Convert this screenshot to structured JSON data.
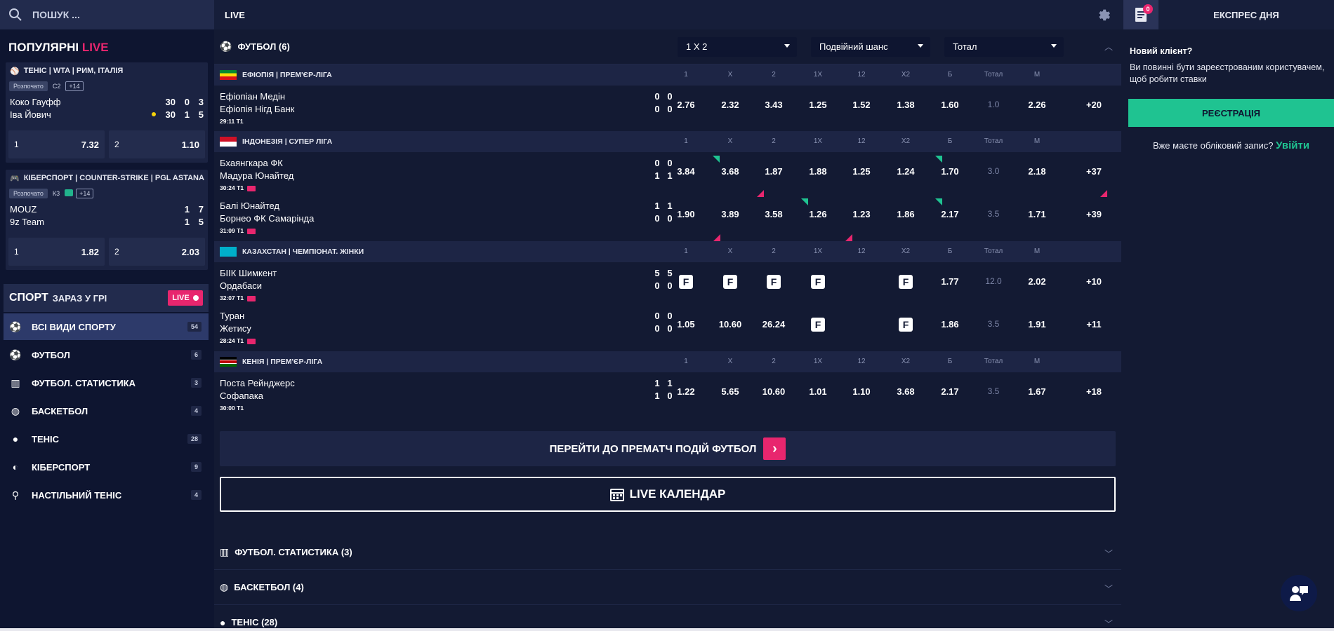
{
  "header": {
    "search_placeholder": "ПОШУК ...",
    "live_label": "LIVE",
    "betslip_count": "0",
    "express_label": "ЕКСПРЕС ДНЯ"
  },
  "popular": {
    "title_main": "ПОПУЛЯРНІ",
    "title_live": "LIVE",
    "cards": [
      {
        "header": "ТЕНІС | WTA | РИМ, ІТАЛІЯ",
        "status": "Розпочато",
        "set_label": "С2",
        "more": "+14",
        "team1": "Коко Гауфф",
        "t1s1": "30",
        "t1s2": "0",
        "t1s3": "3",
        "team2": "Іва Йович",
        "t2s1": "30",
        "t2s2": "1",
        "t2s3": "5",
        "odd1_label": "1",
        "odd1": "7.32",
        "odd2_label": "2",
        "odd2": "1.10"
      },
      {
        "header": "КІБЕРСПОРТ | COUNTER-STRIKE | PGL ASTANA",
        "status": "Розпочато",
        "set_label": "К3",
        "more": "+14",
        "team1": "MOUZ",
        "t1s1": "1",
        "t1s2": "7",
        "team2": "9z Team",
        "t2s1": "1",
        "t2s2": "5",
        "odd1_label": "1",
        "odd1": "1.82",
        "odd2_label": "2",
        "odd2": "2.03"
      }
    ]
  },
  "sports_nav": {
    "title_main": "СПОРТ",
    "title_sub": "ЗАРАЗ У ГРІ",
    "live_pill": "LIVE",
    "items": [
      {
        "label": "ВСІ ВИДИ СПОРТУ",
        "count": "54"
      },
      {
        "label": "ФУТБОЛ",
        "count": "6"
      },
      {
        "label": "ФУТБОЛ. СТАТИСТИКА",
        "count": "3"
      },
      {
        "label": "БАСКЕТБОЛ",
        "count": "4"
      },
      {
        "label": "ТЕНІС",
        "count": "28"
      },
      {
        "label": "КІБЕРСПОРТ",
        "count": "9"
      },
      {
        "label": "НАСТІЛЬНИЙ ТЕНІС",
        "count": "4"
      }
    ]
  },
  "main": {
    "football_title": "ФУТБОЛ (6)",
    "dropdowns": [
      "1 X 2",
      "Подвійний шанс",
      "Тотал"
    ],
    "columns": [
      "1",
      "X",
      "2",
      "1X",
      "12",
      "X2",
      "Б",
      "Тотал",
      "М"
    ],
    "leagues": [
      {
        "name": "ЕФІОПІЯ | ПРЕМ'ЄР-ЛІГА",
        "matches": [
          {
            "team1": "Ефіопіан Медін",
            "team2": "Ефіопія Нігд Банк",
            "time": "29:11",
            "period": "T1",
            "s1a": "0",
            "s1b": "0",
            "s2a": "0",
            "s2b": "0",
            "odds": [
              "2.76",
              "2.32",
              "3.43",
              "1.25",
              "1.52",
              "1.38",
              "1.60",
              "1.0",
              "2.26"
            ],
            "more": "+20"
          }
        ]
      },
      {
        "name": "ІНДОНЕЗІЯ | СУПЕР ЛІГА",
        "matches": [
          {
            "team1": "Бхаянгкара ФК",
            "team2": "Мадура Юнайтед",
            "time": "30:24",
            "period": "T1",
            "s1a": "0",
            "s1b": "0",
            "s2a": "1",
            "s2b": "1",
            "odds": [
              "3.84",
              "3.68",
              "1.87",
              "1.88",
              "1.25",
              "1.24",
              "1.70",
              "3.0",
              "2.18"
            ],
            "more": "+37"
          },
          {
            "team1": "Балі Юнайтед",
            "team2": "Борнео ФК Самарінда",
            "time": "31:09",
            "period": "T1",
            "s1a": "1",
            "s1b": "1",
            "s2a": "0",
            "s2b": "0",
            "odds": [
              "1.90",
              "3.89",
              "3.58",
              "1.26",
              "1.23",
              "1.86",
              "2.17",
              "3.5",
              "1.71"
            ],
            "more": "+39"
          }
        ]
      },
      {
        "name": "КАЗАХСТАН | ЧЕМПІОНАТ. ЖІНКИ",
        "matches": [
          {
            "team1": "БІІК Шимкент",
            "team2": "Ордабаси",
            "time": "32:07",
            "period": "T1",
            "s1a": "5",
            "s1b": "5",
            "s2a": "0",
            "s2b": "0",
            "odds": [
              "F",
              "F",
              "F",
              "F",
              "",
              "F",
              "1.77",
              "12.0",
              "2.02"
            ],
            "more": "+10"
          },
          {
            "team1": "Туран",
            "team2": "Жетису",
            "time": "28:24",
            "period": "T1",
            "s1a": "0",
            "s1b": "0",
            "s2a": "0",
            "s2b": "0",
            "odds": [
              "1.05",
              "10.60",
              "26.24",
              "F",
              "",
              "F",
              "1.86",
              "3.5",
              "1.91"
            ],
            "more": "+11"
          }
        ]
      },
      {
        "name": "КЕНІЯ | ПРЕМ'ЄР-ЛІГА",
        "matches": [
          {
            "team1": "Поста Рейнджерс",
            "team2": "Софапака",
            "time": "30:00",
            "period": "T1",
            "s1a": "1",
            "s1b": "1",
            "s2a": "1",
            "s2b": "0",
            "odds": [
              "1.22",
              "5.65",
              "10.60",
              "1.01",
              "1.10",
              "3.68",
              "2.17",
              "3.5",
              "1.67"
            ],
            "more": "+18"
          }
        ]
      }
    ],
    "prematch_label": "ПЕРЕЙТИ ДО ПРЕМАТЧ ПОДІЙ ФУТБОЛ",
    "calendar_label": "LIVE КАЛЕНДАР",
    "collapsed_sections": [
      "ФУТБОЛ. СТАТИСТИКА (3)",
      "БАСКЕТБОЛ (4)",
      "ТЕНІС (28)"
    ]
  },
  "right_panel": {
    "new_client_title": "Новий клієнт?",
    "new_client_text": "Ви повинні бути зареєстрованим користувачем, щоб робити ставки",
    "register_label": "РЕЄСТРАЦІЯ",
    "login_prompt": "Вже маєте обліковий запис?",
    "login_link": "Увійти"
  },
  "colors": {
    "accent_pink": "#e8266e",
    "accent_green": "#1fc391",
    "bg": "#131a33"
  }
}
